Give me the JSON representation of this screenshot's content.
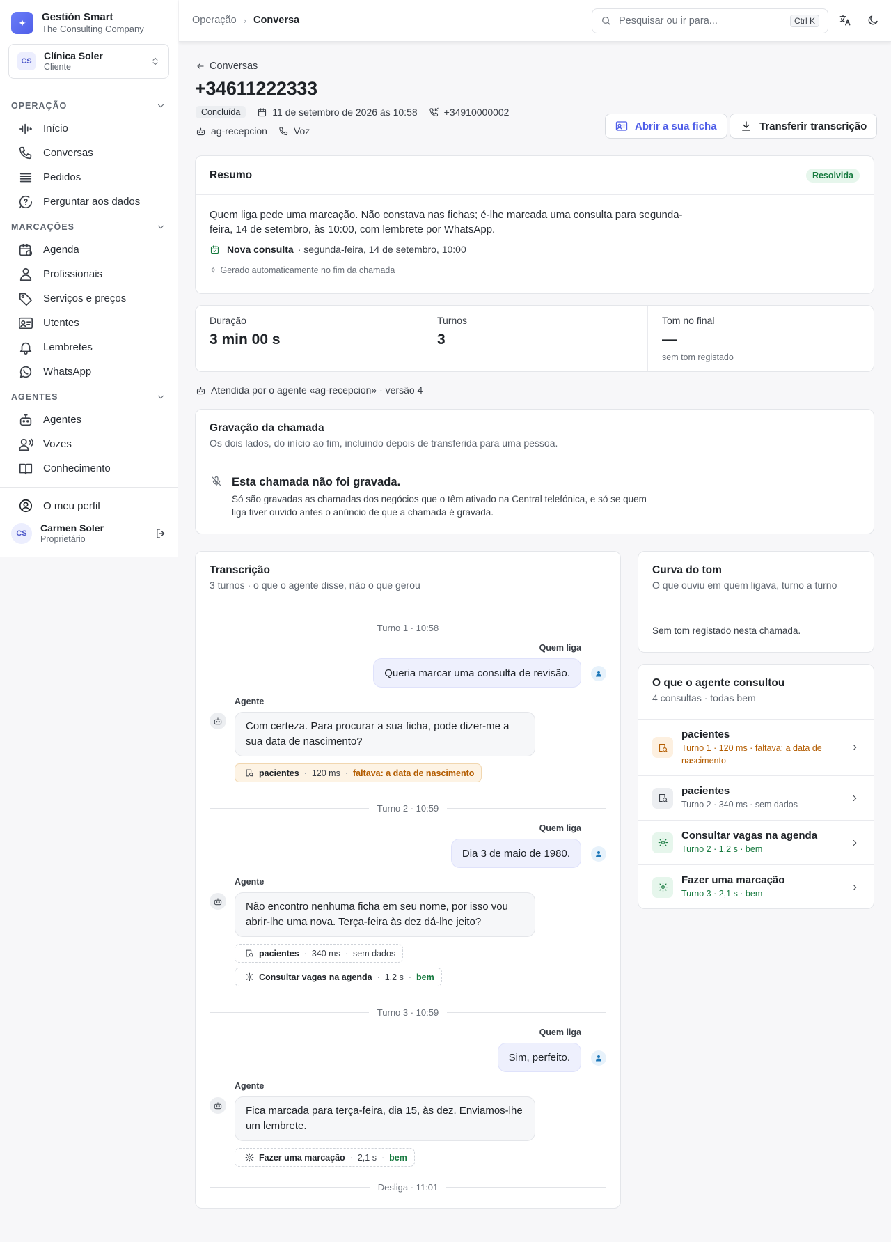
{
  "brand": {
    "name": "Gestión Smart",
    "company": "The Consulting Company"
  },
  "client": {
    "initials": "CS",
    "name": "Clínica Soler",
    "role": "Cliente"
  },
  "nav": {
    "sections": [
      {
        "title": "OPERAÇÃO",
        "items": [
          "Início",
          "Conversas",
          "Pedidos",
          "Perguntar aos dados"
        ]
      },
      {
        "title": "MARCAÇÕES",
        "items": [
          "Agenda",
          "Profissionais",
          "Serviços e preços",
          "Utentes",
          "Lembretes",
          "WhatsApp"
        ]
      },
      {
        "title": "AGENTES",
        "items": [
          "Agentes",
          "Vozes",
          "Conhecimento"
        ]
      }
    ]
  },
  "footer": {
    "profile": "O meu perfil",
    "user_initials": "CS",
    "user_name": "Carmen Soler",
    "user_role": "Proprietário"
  },
  "topbar": {
    "breadcrumb": [
      "Operação",
      "Conversa"
    ],
    "search_placeholder": "Pesquisar ou ir para...",
    "search_shortcut": "Ctrl K"
  },
  "conversation": {
    "back": "Conversas",
    "phone": "+34611222333",
    "status": "Concluída",
    "datetime": "11 de setembro de 2026 às 10:58",
    "to_number": "+34910000002",
    "agent": "ag-recepcion",
    "channel": "Voz",
    "open_record": "Abrir a sua ficha",
    "download": "Transferir transcrição"
  },
  "summary": {
    "title": "Resumo",
    "badge": "Resolvida",
    "text": "Quem liga pede uma marcação. Não constava nas fichas; é-lhe marcada uma consulta para segunda-feira, 14 de setembro, às 10:00, com lembrete por WhatsApp.",
    "event_label": "Nova consulta",
    "event_detail": "· segunda-feira, 14 de setembro, 10:00",
    "generated": "Gerado automaticamente no fim da chamada"
  },
  "stats": [
    {
      "label": "Duração",
      "value": "3 min 00 s",
      "sub": ""
    },
    {
      "label": "Turnos",
      "value": "3",
      "sub": ""
    },
    {
      "label": "Tom no final",
      "value": "—",
      "sub": "sem tom registado"
    }
  ],
  "attended_by": "Atendida por o agente «ag-recepcion» · versão 4",
  "recording": {
    "title": "Gravação da chamada",
    "subtitle": "Os dois lados, do início ao fim, incluindo depois de transferida para uma pessoa.",
    "none_title": "Esta chamada não foi gravada.",
    "none_text": "Só são gravadas as chamadas dos negócios que o têm ativado na Central telefónica, e só se quem liga tiver ouvido antes o anúncio de que a chamada é gravada."
  },
  "transcript": {
    "title": "Transcrição",
    "subtitle": "3 turnos · o que o agente disse, não o que gerou",
    "caller_label": "Quem liga",
    "agent_label": "Agente",
    "turns": [
      {
        "divider": "Turno 1 · 10:58",
        "caller": "Queria marcar uma consulta de revisão.",
        "agent": "Com certeza. Para procurar a sua ficha, pode dizer-me a sua data de nascimento?",
        "tools": [
          {
            "name": "pacientes",
            "time": "120 ms",
            "result": "faltava: a data de nascimento"
          }
        ]
      },
      {
        "divider": "Turno 2 · 10:59",
        "caller": "Dia 3 de maio de 1980.",
        "agent": "Não encontro nenhuma ficha em seu nome, por isso vou abrir-lhe uma nova. Terça-feira às dez dá-lhe jeito?",
        "tools": [
          {
            "name": "pacientes",
            "time": "340 ms",
            "result": "sem dados"
          },
          {
            "name": "Consultar vagas na agenda",
            "time": "1,2 s",
            "result": "bem"
          }
        ]
      },
      {
        "divider": "Turno 3 · 10:59",
        "caller": "Sim, perfeito.",
        "agent": "Fica marcada para terça-feira, dia 15, às dez. Enviamos-lhe um lembrete.",
        "tools": [
          {
            "name": "Fazer uma marcação",
            "time": "2,1 s",
            "result": "bem"
          }
        ]
      }
    ],
    "end": "Desliga · 11:01"
  },
  "tone": {
    "title": "Curva do tom",
    "subtitle": "O que ouviu em quem ligava, turno a turno",
    "empty": "Sem tom registado nesta chamada."
  },
  "consults": {
    "title": "O que o agente consultou",
    "subtitle": "4 consultas · todas bem",
    "items": [
      {
        "name": "pacientes",
        "detail": "Turno 1 · 120 ms · faltava: a data de nascimento"
      },
      {
        "name": "pacientes",
        "detail": "Turno 2 · 340 ms · sem dados"
      },
      {
        "name": "Consultar vagas na agenda",
        "detail": "Turno 2 · 1,2 s · bem"
      },
      {
        "name": "Fazer uma marcação",
        "detail": "Turno 3 · 2,1 s · bem"
      }
    ]
  },
  "colors": {
    "accent": "#4f5ee8",
    "success": "#177a3f",
    "warning": "#b35c00"
  }
}
